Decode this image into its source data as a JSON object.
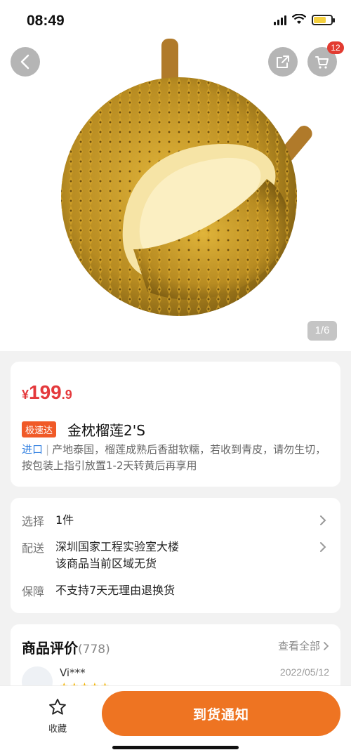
{
  "status": {
    "time": "08:49"
  },
  "hero": {
    "cart_count": "12",
    "page_indicator": "1/6"
  },
  "product": {
    "price_symbol": "¥",
    "price_int": "199",
    "price_dec": ".9",
    "tag": "极速达",
    "title": "金枕榴莲2'S",
    "origin_label": "进口",
    "separator": "|",
    "description": "产地泰国，榴莲成熟后香甜软糯，若收到青皮，请勿生切，按包装上指引放置1-2天转黄后再享用"
  },
  "options": {
    "select_label": "选择",
    "select_value": "1件",
    "delivery_label": "配送",
    "delivery_address": "深圳国家工程实验室大楼",
    "delivery_status": "该商品当前区域无货",
    "guarantee_label": "保障",
    "guarantee_value": "不支持7天无理由退换货"
  },
  "reviews": {
    "title": "商品评价",
    "count": "(778)",
    "view_all": "查看全部",
    "first": {
      "name": "Vi***",
      "date": "2022/05/12",
      "rating": 5
    }
  },
  "bottom": {
    "favorite_label": "收藏",
    "notify_label": "到货通知"
  },
  "colors": {
    "price": "#e4393c",
    "accent": "#ee7422",
    "tag": "#f05a28",
    "import": "#2d7de0"
  }
}
